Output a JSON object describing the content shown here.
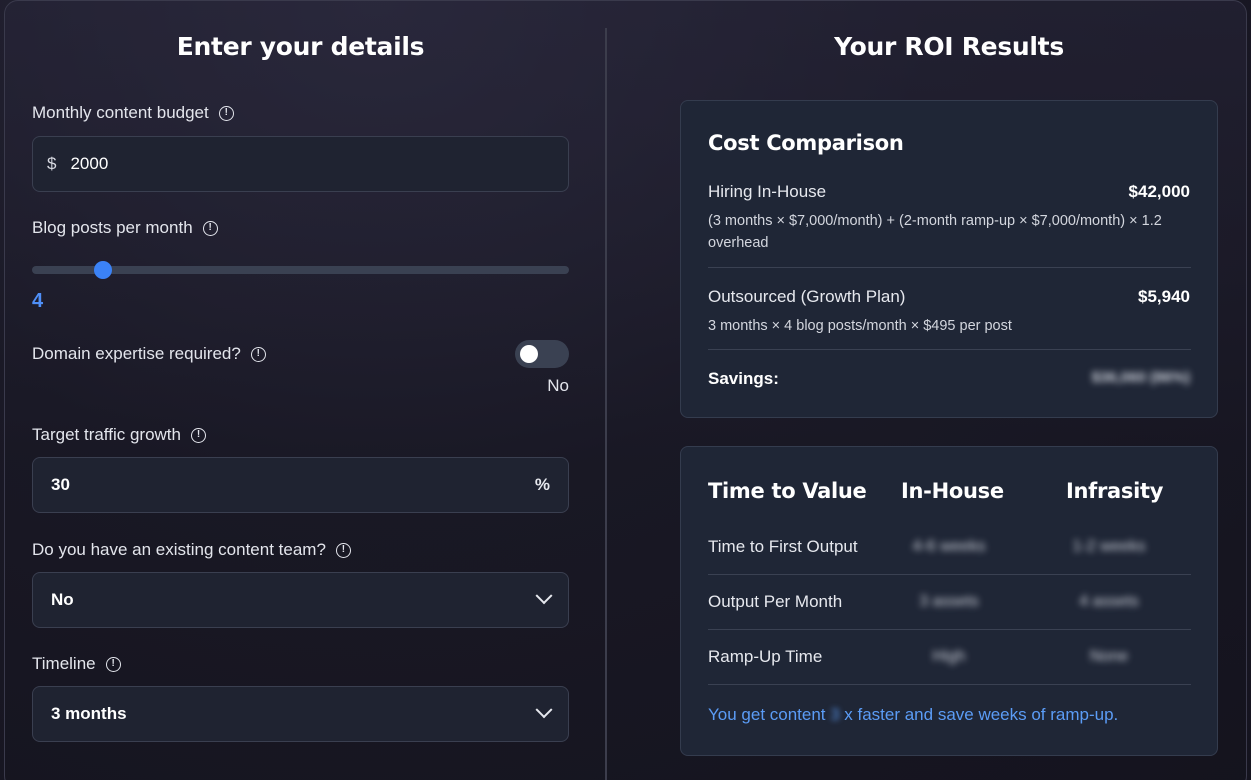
{
  "left": {
    "title": "Enter your details",
    "budget": {
      "label": "Monthly content budget",
      "prefix": "$",
      "value": "2000"
    },
    "blog_posts": {
      "label": "Blog posts per month",
      "value": "4",
      "min": 1,
      "max": 50,
      "current": 4
    },
    "domain": {
      "label": "Domain expertise required?",
      "state": "No",
      "on": false
    },
    "traffic": {
      "label": "Target traffic growth",
      "value": "30",
      "suffix": "%"
    },
    "team": {
      "label": "Do you have an existing content team?",
      "selected": "No"
    },
    "timeline": {
      "label": "Timeline",
      "selected": "3 months"
    }
  },
  "right": {
    "title": "Your ROI Results",
    "cost": {
      "title": "Cost Comparison",
      "inhouse_label": "Hiring In-House",
      "inhouse_value": "$42,000",
      "inhouse_detail": "(3 months × $7,000/month) + (2-month ramp-up × $7,000/month) × 1.2 overhead",
      "outsourced_label": "Outsourced (Growth Plan)",
      "outsourced_value": "$5,940",
      "outsourced_detail": "3 months × 4 blog posts/month × $495 per post",
      "savings_label": "Savings:",
      "savings_value": "$36,060 (86%)"
    },
    "time": {
      "col1": "Time to Value",
      "col2": "In-House",
      "col3": "Infrasity",
      "rows": [
        {
          "label": "Time to First Output",
          "inhouse": "4-6 weeks",
          "infrasity": "1-2 weeks"
        },
        {
          "label": "Output Per Month",
          "inhouse": "3 assets",
          "infrasity": "4 assets"
        },
        {
          "label": "Ramp-Up Time",
          "inhouse": "High",
          "infrasity": "None"
        }
      ],
      "footer_pre": "You get content ",
      "footer_mid": "3",
      "footer_post": "x faster and save weeks of ramp-up."
    }
  },
  "colors": {
    "accent": "#3b82f6",
    "link": "#5b9cf6",
    "card": "#1f2636"
  }
}
